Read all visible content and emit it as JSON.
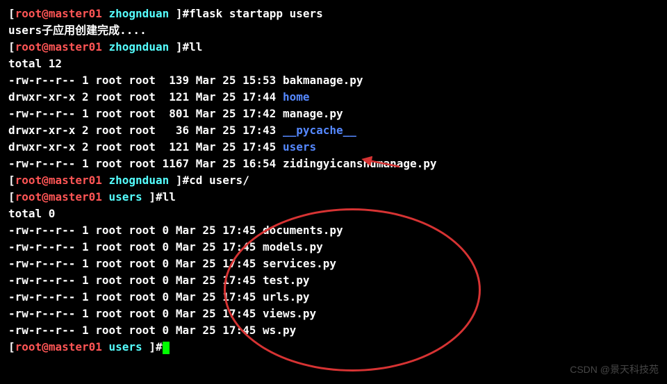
{
  "prompts": [
    {
      "user": "root",
      "host": "master01",
      "dir": "zhognduan",
      "cmd": "flask startapp users"
    }
  ],
  "output1": "users子应用创建完成....",
  "prompt2": {
    "user": "root",
    "host": "master01",
    "dir": "zhognduan",
    "cmd": "ll"
  },
  "total1": "total 12",
  "listing1": [
    {
      "perms": "-rw-r--r--",
      "links": "1",
      "owner": "root",
      "group": "root",
      "size": " 139",
      "date": "Mar 25 15:53",
      "name": "bakmanage.py",
      "color": "white"
    },
    {
      "perms": "drwxr-xr-x",
      "links": "2",
      "owner": "root",
      "group": "root",
      "size": " 121",
      "date": "Mar 25 17:44",
      "name": "home",
      "color": "blue"
    },
    {
      "perms": "-rw-r--r--",
      "links": "1",
      "owner": "root",
      "group": "root",
      "size": " 801",
      "date": "Mar 25 17:42",
      "name": "manage.py",
      "color": "white"
    },
    {
      "perms": "drwxr-xr-x",
      "links": "2",
      "owner": "root",
      "group": "root",
      "size": "  36",
      "date": "Mar 25 17:43",
      "name": "__pycache__",
      "color": "blue"
    },
    {
      "perms": "drwxr-xr-x",
      "links": "2",
      "owner": "root",
      "group": "root",
      "size": " 121",
      "date": "Mar 25 17:45",
      "name": "users",
      "color": "blue"
    },
    {
      "perms": "-rw-r--r--",
      "links": "1",
      "owner": "root",
      "group": "root",
      "size": "1167",
      "date": "Mar 25 16:54",
      "name": "zidingyicanshumanage.py",
      "color": "white"
    }
  ],
  "prompt3": {
    "user": "root",
    "host": "master01",
    "dir": "zhognduan",
    "cmd": "cd users/"
  },
  "prompt4": {
    "user": "root",
    "host": "master01",
    "dir": "users",
    "cmd": "ll"
  },
  "total2": "total 0",
  "listing2": [
    {
      "perms": "-rw-r--r--",
      "links": "1",
      "owner": "root",
      "group": "root",
      "size": "0",
      "date": "Mar 25 17:45",
      "name": "documents.py"
    },
    {
      "perms": "-rw-r--r--",
      "links": "1",
      "owner": "root",
      "group": "root",
      "size": "0",
      "date": "Mar 25 17:45",
      "name": "models.py"
    },
    {
      "perms": "-rw-r--r--",
      "links": "1",
      "owner": "root",
      "group": "root",
      "size": "0",
      "date": "Mar 25 17:45",
      "name": "services.py"
    },
    {
      "perms": "-rw-r--r--",
      "links": "1",
      "owner": "root",
      "group": "root",
      "size": "0",
      "date": "Mar 25 17:45",
      "name": "test.py"
    },
    {
      "perms": "-rw-r--r--",
      "links": "1",
      "owner": "root",
      "group": "root",
      "size": "0",
      "date": "Mar 25 17:45",
      "name": "urls.py"
    },
    {
      "perms": "-rw-r--r--",
      "links": "1",
      "owner": "root",
      "group": "root",
      "size": "0",
      "date": "Mar 25 17:45",
      "name": "views.py"
    },
    {
      "perms": "-rw-r--r--",
      "links": "1",
      "owner": "root",
      "group": "root",
      "size": "0",
      "date": "Mar 25 17:45",
      "name": "ws.py"
    }
  ],
  "prompt5": {
    "user": "root",
    "host": "master01",
    "dir": "users",
    "cmd": ""
  },
  "watermark": "CSDN @景天科技苑"
}
